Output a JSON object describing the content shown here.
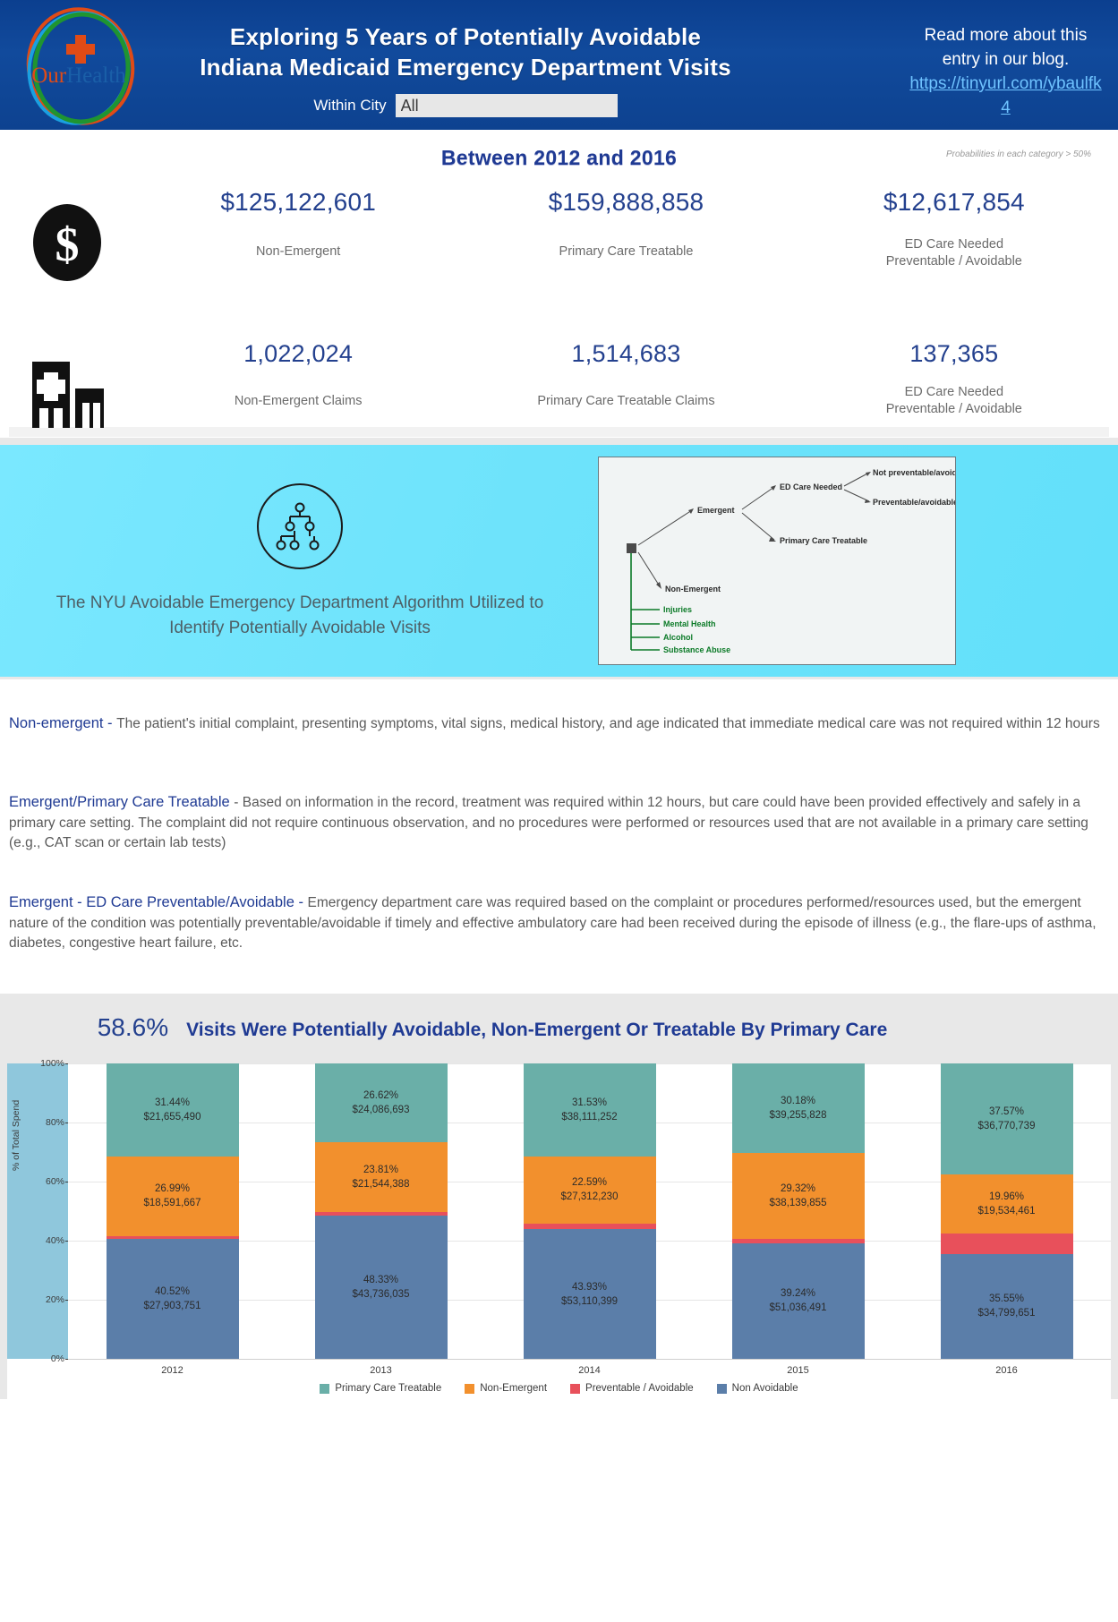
{
  "header": {
    "logo": {
      "name": "ourhealth-logo",
      "text_our": "Our",
      "text_health": "Health"
    },
    "title_line1": "Exploring 5 Years of Potentially Avoidable",
    "title_line2": "Indiana Medicaid Emergency Department Visits",
    "filter_label": "Within City",
    "filter_value": "All",
    "blog_text": "Read more about this entry in our blog.",
    "blog_link": "https://tinyurl.com/ybaulfk4",
    "colors": {
      "header_bg": "#0d4290",
      "link": "#6fc3ff"
    }
  },
  "kpi": {
    "between_title": "Between 2012 and 2016",
    "prob_note": "Probabilities in each category > 50%",
    "row1_icon": "dollar-icon",
    "row2_icon": "hospital-icon",
    "row1": [
      {
        "value": "$125,122,601",
        "label": "Non-Emergent"
      },
      {
        "value": "$159,888,858",
        "label": "Primary Care Treatable"
      },
      {
        "value": "$12,617,854",
        "label": "ED Care Needed\nPreventable / Avoidable"
      }
    ],
    "row2": [
      {
        "value": "1,022,024",
        "label": "Non-Emergent Claims"
      },
      {
        "value": "1,514,683",
        "label": "Primary Care Treatable Claims"
      },
      {
        "value": "137,365",
        "label": "ED Care Needed\nPreventable / Avoidable"
      }
    ]
  },
  "algorithm": {
    "icon": "hierarchy-tree-icon",
    "text": "The NYU Avoidable Emergency Department Algorithm Utilized to Identify Potentially Avoidable Visits",
    "bg_color": "#6ee3fb",
    "tree": {
      "root": "",
      "nodes": [
        "Emergent",
        "ED Care Needed",
        "Not preventable/avoidable",
        "Preventable/avoidable",
        "Primary Care Treatable",
        "Non-Emergent"
      ],
      "green_nodes": [
        "Injuries",
        "Mental Health",
        "Alcohol",
        "Substance Abuse"
      ],
      "green_color": "#0b7a27"
    }
  },
  "definitions": [
    {
      "head": "Non-emergent - ",
      "body": "The patient's initial complaint, presenting symptoms, vital signs, medical history, and age indicated that immediate medical care was not required within 12 hours"
    },
    {
      "head": "Emergent/Primary Care Treatable ",
      "body": "- Based on information in the record, treatment was required within 12 hours, but care could have been provided effectively and safely in a primary care setting. The complaint did not require continuous observation, and no procedures were performed or resources used that are not available in a primary care setting (e.g., CAT scan or certain lab tests)"
    },
    {
      "head": "Emergent - ED Care Preventable/Avoidable - ",
      "body": "Emergency department care was required based on the complaint or procedures performed/resources used, but the emergent nature of the condition was potentially preventable/avoidable if timely and effective ambulatory care had been received during the episode of illness (e.g., the flare-ups of asthma, diabetes, congestive heart failure, etc."
    }
  ],
  "chart_section": {
    "pct": "58.6%",
    "headline": "Visits Were Potentially Avoidable, Non-Emergent Or Treatable By Primary Care"
  },
  "chart_data": {
    "type": "bar",
    "stacked": true,
    "stack_mode": "percent",
    "title": "",
    "xlabel": "",
    "ylabel": "% of Total Spend",
    "ylim": [
      0,
      100
    ],
    "ytick_labels": [
      "0%",
      "20%",
      "40%",
      "60%",
      "80%",
      "100%"
    ],
    "grid": true,
    "legend_position": "bottom",
    "categories": [
      "2012",
      "2013",
      "2014",
      "2015",
      "2016"
    ],
    "series": [
      {
        "name": "Primary Care Treatable",
        "color": "#6aafa8",
        "values": [
          31.44,
          26.62,
          31.53,
          30.18,
          37.57
        ],
        "amounts": [
          "$21,655,490",
          "$24,086,693",
          "$38,111,252",
          "$39,255,828",
          "$36,770,739"
        ],
        "labels": [
          "31.44%",
          "26.62%",
          "31.53%",
          "30.18%",
          "37.57%"
        ]
      },
      {
        "name": "Non-Emergent",
        "color": "#f2902d",
        "values": [
          26.99,
          23.81,
          22.59,
          29.32,
          19.96
        ],
        "amounts": [
          "$18,591,667",
          "$21,544,388",
          "$27,312,230",
          "$38,139,855",
          "$19,534,461"
        ],
        "labels": [
          "26.99%",
          "23.81%",
          "22.59%",
          "29.32%",
          "19.96%"
        ]
      },
      {
        "name": "Preventable / Avoidable",
        "color": "#e8505b",
        "values": [
          1.05,
          1.24,
          1.95,
          1.26,
          6.92
        ],
        "amounts": [
          "",
          "",
          "",
          "",
          ""
        ],
        "labels": [
          "",
          "",
          "",
          "",
          ""
        ]
      },
      {
        "name": "Non Avoidable",
        "color": "#5b7ea9",
        "values": [
          40.52,
          48.33,
          43.93,
          39.24,
          35.55
        ],
        "amounts": [
          "$27,903,751",
          "$43,736,035",
          "$53,110,399",
          "$51,036,491",
          "$34,799,651"
        ],
        "labels": [
          "40.52%",
          "48.33%",
          "43.93%",
          "39.24%",
          "35.55%"
        ]
      }
    ]
  }
}
